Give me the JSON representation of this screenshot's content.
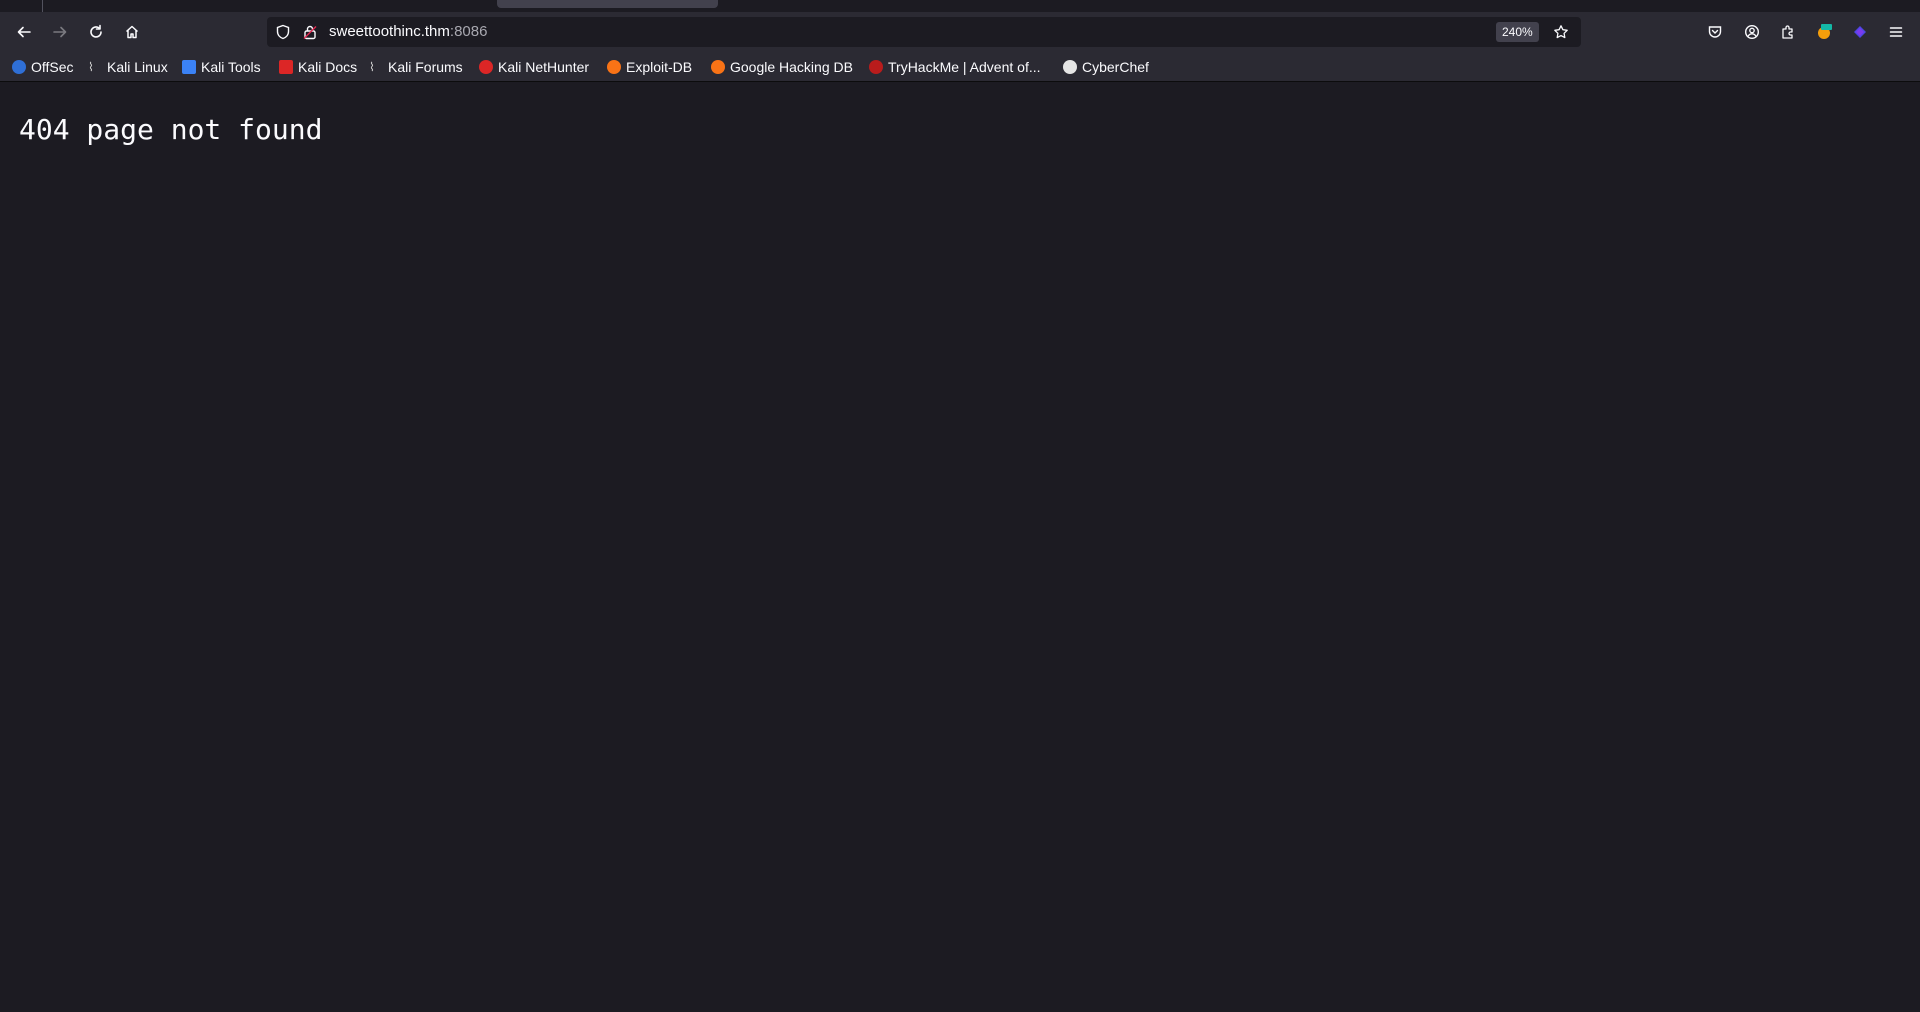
{
  "browser": {
    "url_host": "sweettoothinc.thm",
    "url_port": ":8086",
    "zoom": "240%"
  },
  "bookmarks": [
    {
      "label": "OffSec",
      "icon": "offsec-icon",
      "color": "#2f6fd6"
    },
    {
      "label": "Kali Linux",
      "icon": "kali-dragon-icon",
      "color": "#cfcfcf"
    },
    {
      "label": "Kali Tools",
      "icon": "kali-tools-icon",
      "color": "#3b82f6"
    },
    {
      "label": "Kali Docs",
      "icon": "kali-docs-icon",
      "color": "#dc2626"
    },
    {
      "label": "Kali Forums",
      "icon": "kali-dragon-icon",
      "color": "#cfcfcf"
    },
    {
      "label": "Kali NetHunter",
      "icon": "nethunter-icon",
      "color": "#dc2626"
    },
    {
      "label": "Exploit-DB",
      "icon": "exploitdb-icon",
      "color": "#f97316"
    },
    {
      "label": "Google Hacking DB",
      "icon": "ghdb-icon",
      "color": "#f97316"
    },
    {
      "label": "TryHackMe | Advent of...",
      "icon": "tryhackme-icon",
      "color": "#b91c1c"
    },
    {
      "label": "CyberChef",
      "icon": "cyberchef-icon",
      "color": "#e5e5e5"
    }
  ],
  "page": {
    "heading": "404 page not found"
  }
}
